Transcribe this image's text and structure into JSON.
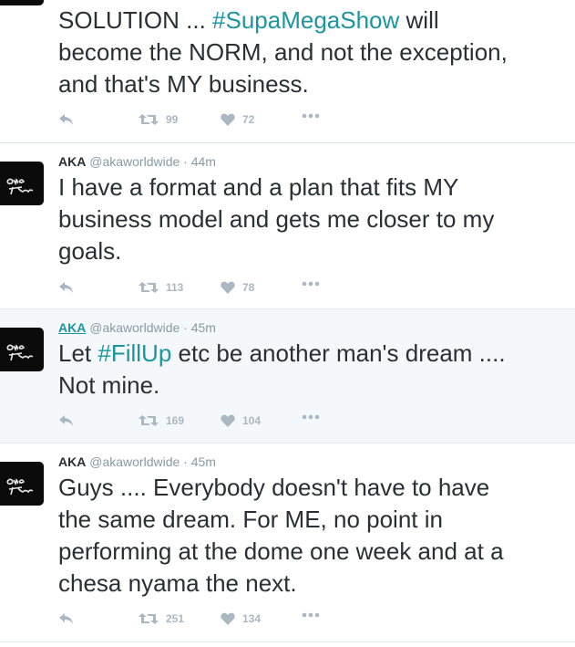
{
  "tweets": [
    {
      "name": "",
      "handle": "",
      "time": "",
      "lines": [
        [
          {
            "t": "SOLUTION ... "
          },
          {
            "t": "#SupaMegaShow",
            "tag": true
          },
          {
            "t": " will"
          }
        ],
        [
          {
            "t": "become the NORM, and not the exception,"
          }
        ],
        [
          {
            "t": "and that's MY business."
          }
        ]
      ],
      "retweets": "99",
      "likes": "72"
    },
    {
      "name": "AKA",
      "handle": "@akaworldwide",
      "time": "44m",
      "lines": [
        [
          {
            "t": "I have a format and a plan that fits MY"
          }
        ],
        [
          {
            "t": "business model and gets me closer to my"
          }
        ],
        [
          {
            "t": "goals."
          }
        ]
      ],
      "retweets": "113",
      "likes": "78"
    },
    {
      "name": "AKA",
      "handle": "@akaworldwide",
      "time": "45m",
      "lines": [
        [
          {
            "t": "Let "
          },
          {
            "t": "#FillUp",
            "tag": true
          },
          {
            "t": " etc be another man's dream ...."
          }
        ],
        [
          {
            "t": "Not mine."
          }
        ]
      ],
      "retweets": "169",
      "likes": "104"
    },
    {
      "name": "AKA",
      "handle": "@akaworldwide",
      "time": "45m",
      "lines": [
        [
          {
            "t": "Guys .... Everybody doesn't have to have"
          }
        ],
        [
          {
            "t": "the same dream. For ME, no point in"
          }
        ],
        [
          {
            "t": "performing at the dome one week and at a"
          }
        ],
        [
          {
            "t": "chesa nyama the next."
          }
        ]
      ],
      "retweets": "251",
      "likes": "134"
    }
  ],
  "icons": {
    "reply": "reply-arrow-icon",
    "retweet": "retweet-icon",
    "like": "heart-icon",
    "more": "more-dots-icon"
  },
  "avatar_text": "one time",
  "colors": {
    "hashtag": "#1b95a0",
    "text": "#292f33",
    "muted": "#8899a6",
    "action": "#aab8c2",
    "highlight_bg": "#f5f8fa",
    "divider": "#e1e8ed"
  }
}
